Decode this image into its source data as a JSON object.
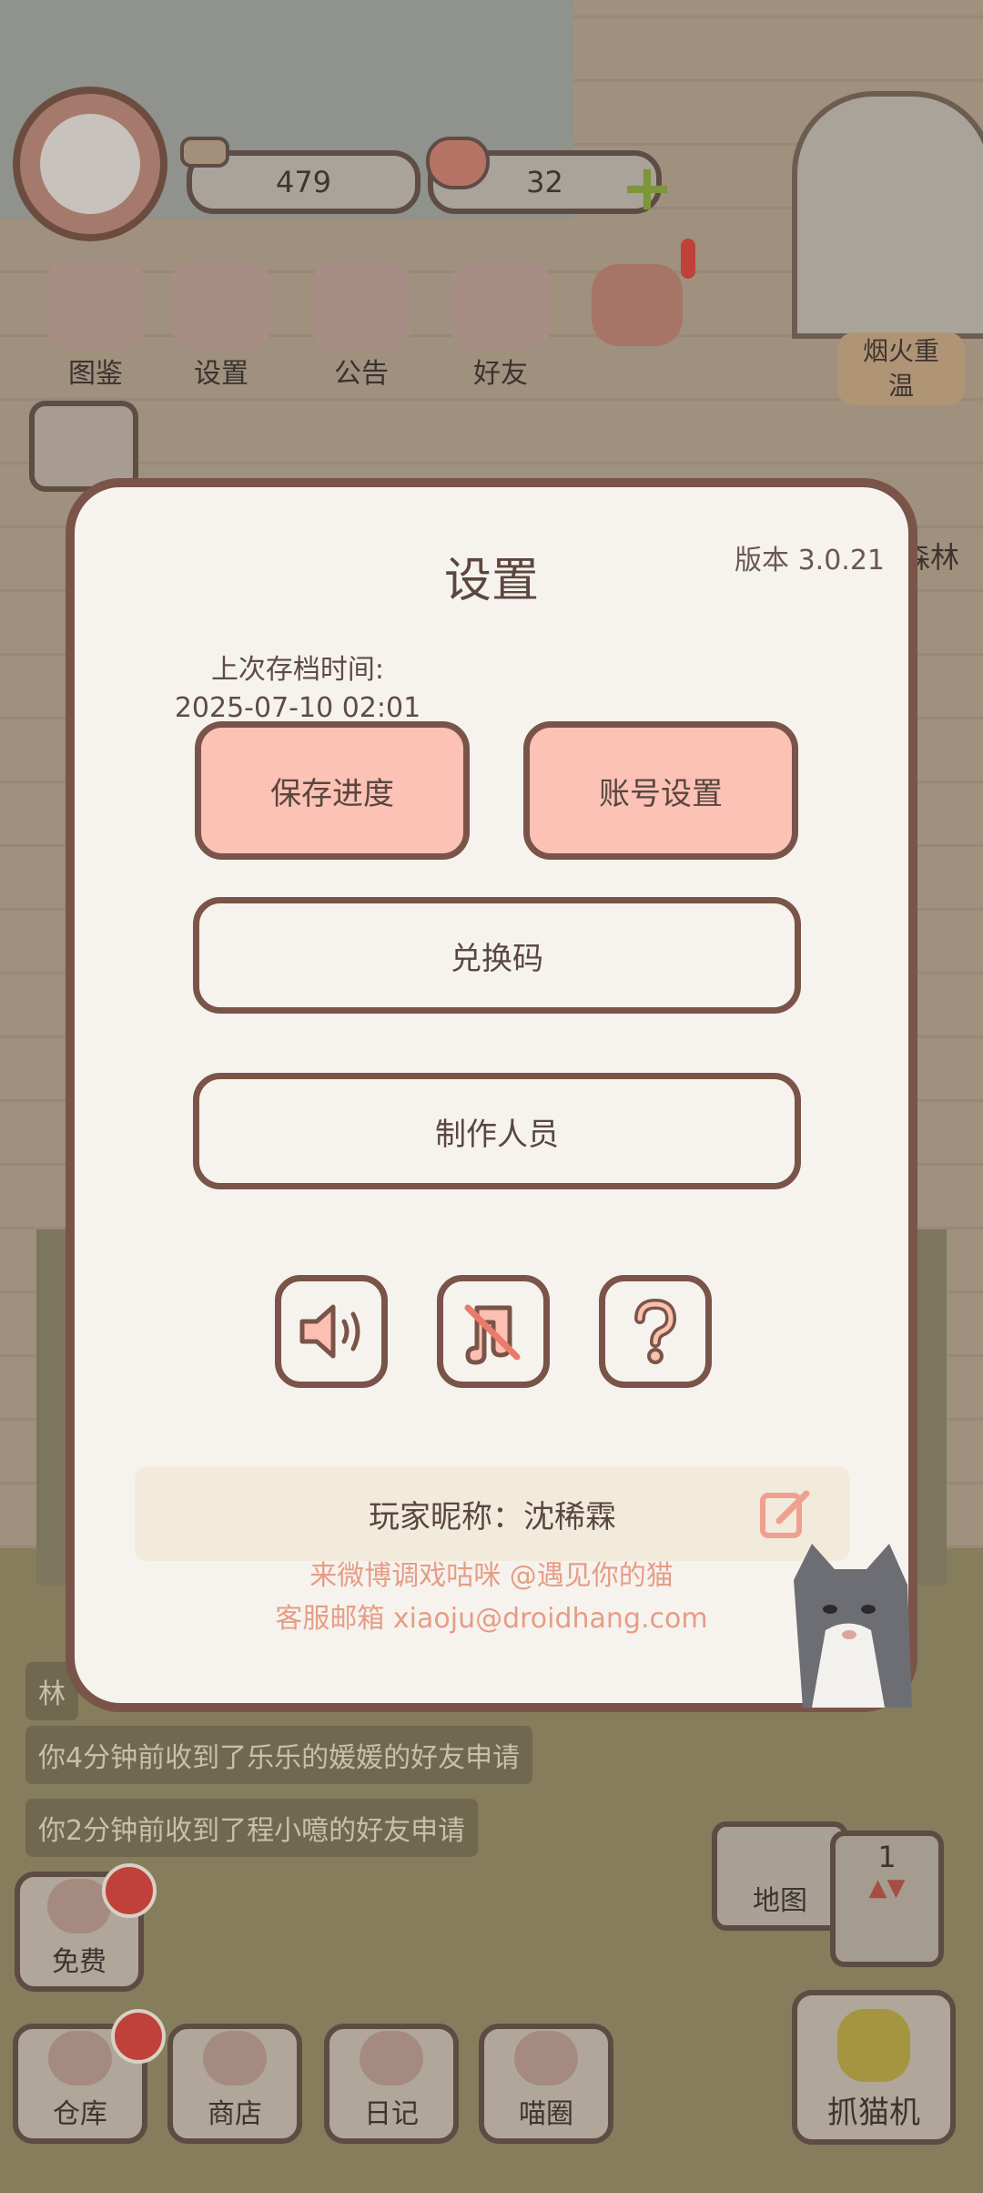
{
  "hud": {
    "fish_count": "479",
    "heart_count": "32",
    "menu": [
      {
        "label": "图鉴",
        "icon": "cat-book-icon"
      },
      {
        "label": "设置",
        "icon": "gear-icon"
      },
      {
        "label": "公告",
        "icon": "gift-icon"
      },
      {
        "label": "好友",
        "icon": "friends-icon"
      }
    ],
    "event_label": "烟火重温",
    "side_tag": "森林"
  },
  "chat": [
    "林",
    "你4分钟前收到了乐乐的媛媛的好友申请",
    "你2分钟前收到了程小噫的好友申请"
  ],
  "bottom": {
    "free_label": "免费",
    "items": [
      {
        "label": "仓库",
        "icon": "warehouse-icon"
      },
      {
        "label": "商店",
        "icon": "shop-icon"
      },
      {
        "label": "日记",
        "icon": "diary-icon"
      },
      {
        "label": "喵圈",
        "icon": "cat-planet-icon"
      }
    ],
    "map_label": "地图",
    "floor_number": "1",
    "claw_label": "抓猫机"
  },
  "dialog": {
    "title": "设置",
    "version": "版本 3.0.21",
    "save_time_label": "上次存档时间:",
    "save_time_value": "2025-07-10 02:01",
    "save_button": "保存进度",
    "account_button": "账号设置",
    "redeem_button": "兑换码",
    "credits_button": "制作人员",
    "nickname_label": "玩家昵称：",
    "nickname_value": "沈稀霖",
    "weibo_text": "来微博调戏咕咪 @遇见你的猫",
    "email_text": "客服邮箱 xiaoju@droidhang.com"
  },
  "colors": {
    "accent_pink": "#fcc2b6",
    "border_brown": "#7a5449",
    "link_orange": "#e69d86"
  }
}
